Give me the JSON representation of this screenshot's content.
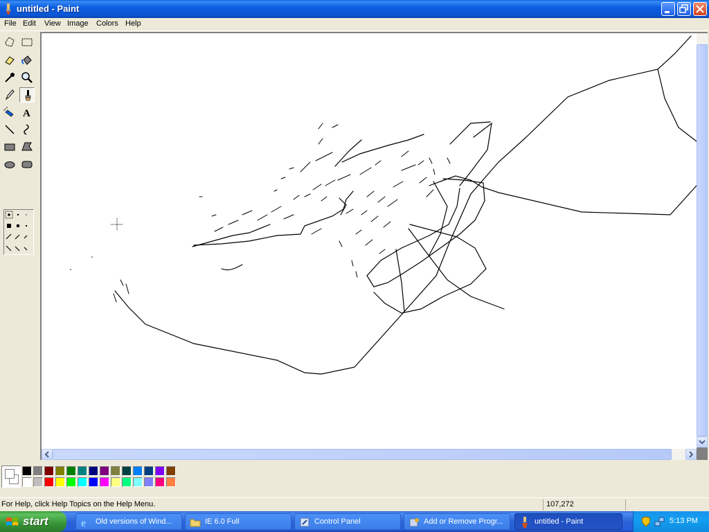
{
  "window": {
    "title": "untitled - Paint"
  },
  "menu": {
    "items": [
      "File",
      "Edit",
      "View",
      "Image",
      "Colors",
      "Help"
    ]
  },
  "tools": [
    {
      "name": "free-form-select-icon"
    },
    {
      "name": "select-icon"
    },
    {
      "name": "eraser-icon"
    },
    {
      "name": "fill-bucket-icon"
    },
    {
      "name": "pick-color-icon"
    },
    {
      "name": "magnifier-icon"
    },
    {
      "name": "pencil-icon"
    },
    {
      "name": "brush-icon",
      "selected": true
    },
    {
      "name": "airbrush-icon"
    },
    {
      "name": "text-icon",
      "glyph": "A"
    },
    {
      "name": "line-icon"
    },
    {
      "name": "curve-icon"
    },
    {
      "name": "rectangle-icon"
    },
    {
      "name": "polygon-icon"
    },
    {
      "name": "ellipse-icon"
    },
    {
      "name": "rounded-rectangle-icon"
    }
  ],
  "palette": {
    "foreground": "#000000",
    "background": "#ffffff",
    "top_row": [
      "#000000",
      "#808080",
      "#800000",
      "#808000",
      "#008000",
      "#008080",
      "#000080",
      "#800080",
      "#808040",
      "#004040",
      "#0080ff",
      "#004080",
      "#8000ff",
      "#804000"
    ],
    "bottom_row": [
      "#ffffff",
      "#c0c0c0",
      "#ff0000",
      "#ffff00",
      "#00ff00",
      "#00ffff",
      "#0000ff",
      "#ff00ff",
      "#ffff80",
      "#00ff80",
      "#80ffff",
      "#8080ff",
      "#ff0080",
      "#ff8040"
    ]
  },
  "status": {
    "help_text": "For Help, click Help Topics on the Help Menu.",
    "coords": "107,272"
  },
  "taskbar": {
    "start_label": "start",
    "tasks": [
      {
        "label": "Old versions of Wind...",
        "icon": "ie-icon"
      },
      {
        "label": "IE 6.0 Full",
        "icon": "folder-icon"
      },
      {
        "label": "Control Panel",
        "icon": "control-panel-icon"
      },
      {
        "label": "Add or Remove Progr...",
        "icon": "add-remove-icon"
      },
      {
        "label": "untitled - Paint",
        "icon": "paint-icon",
        "active": true
      }
    ],
    "clock": "5:13 PM"
  }
}
